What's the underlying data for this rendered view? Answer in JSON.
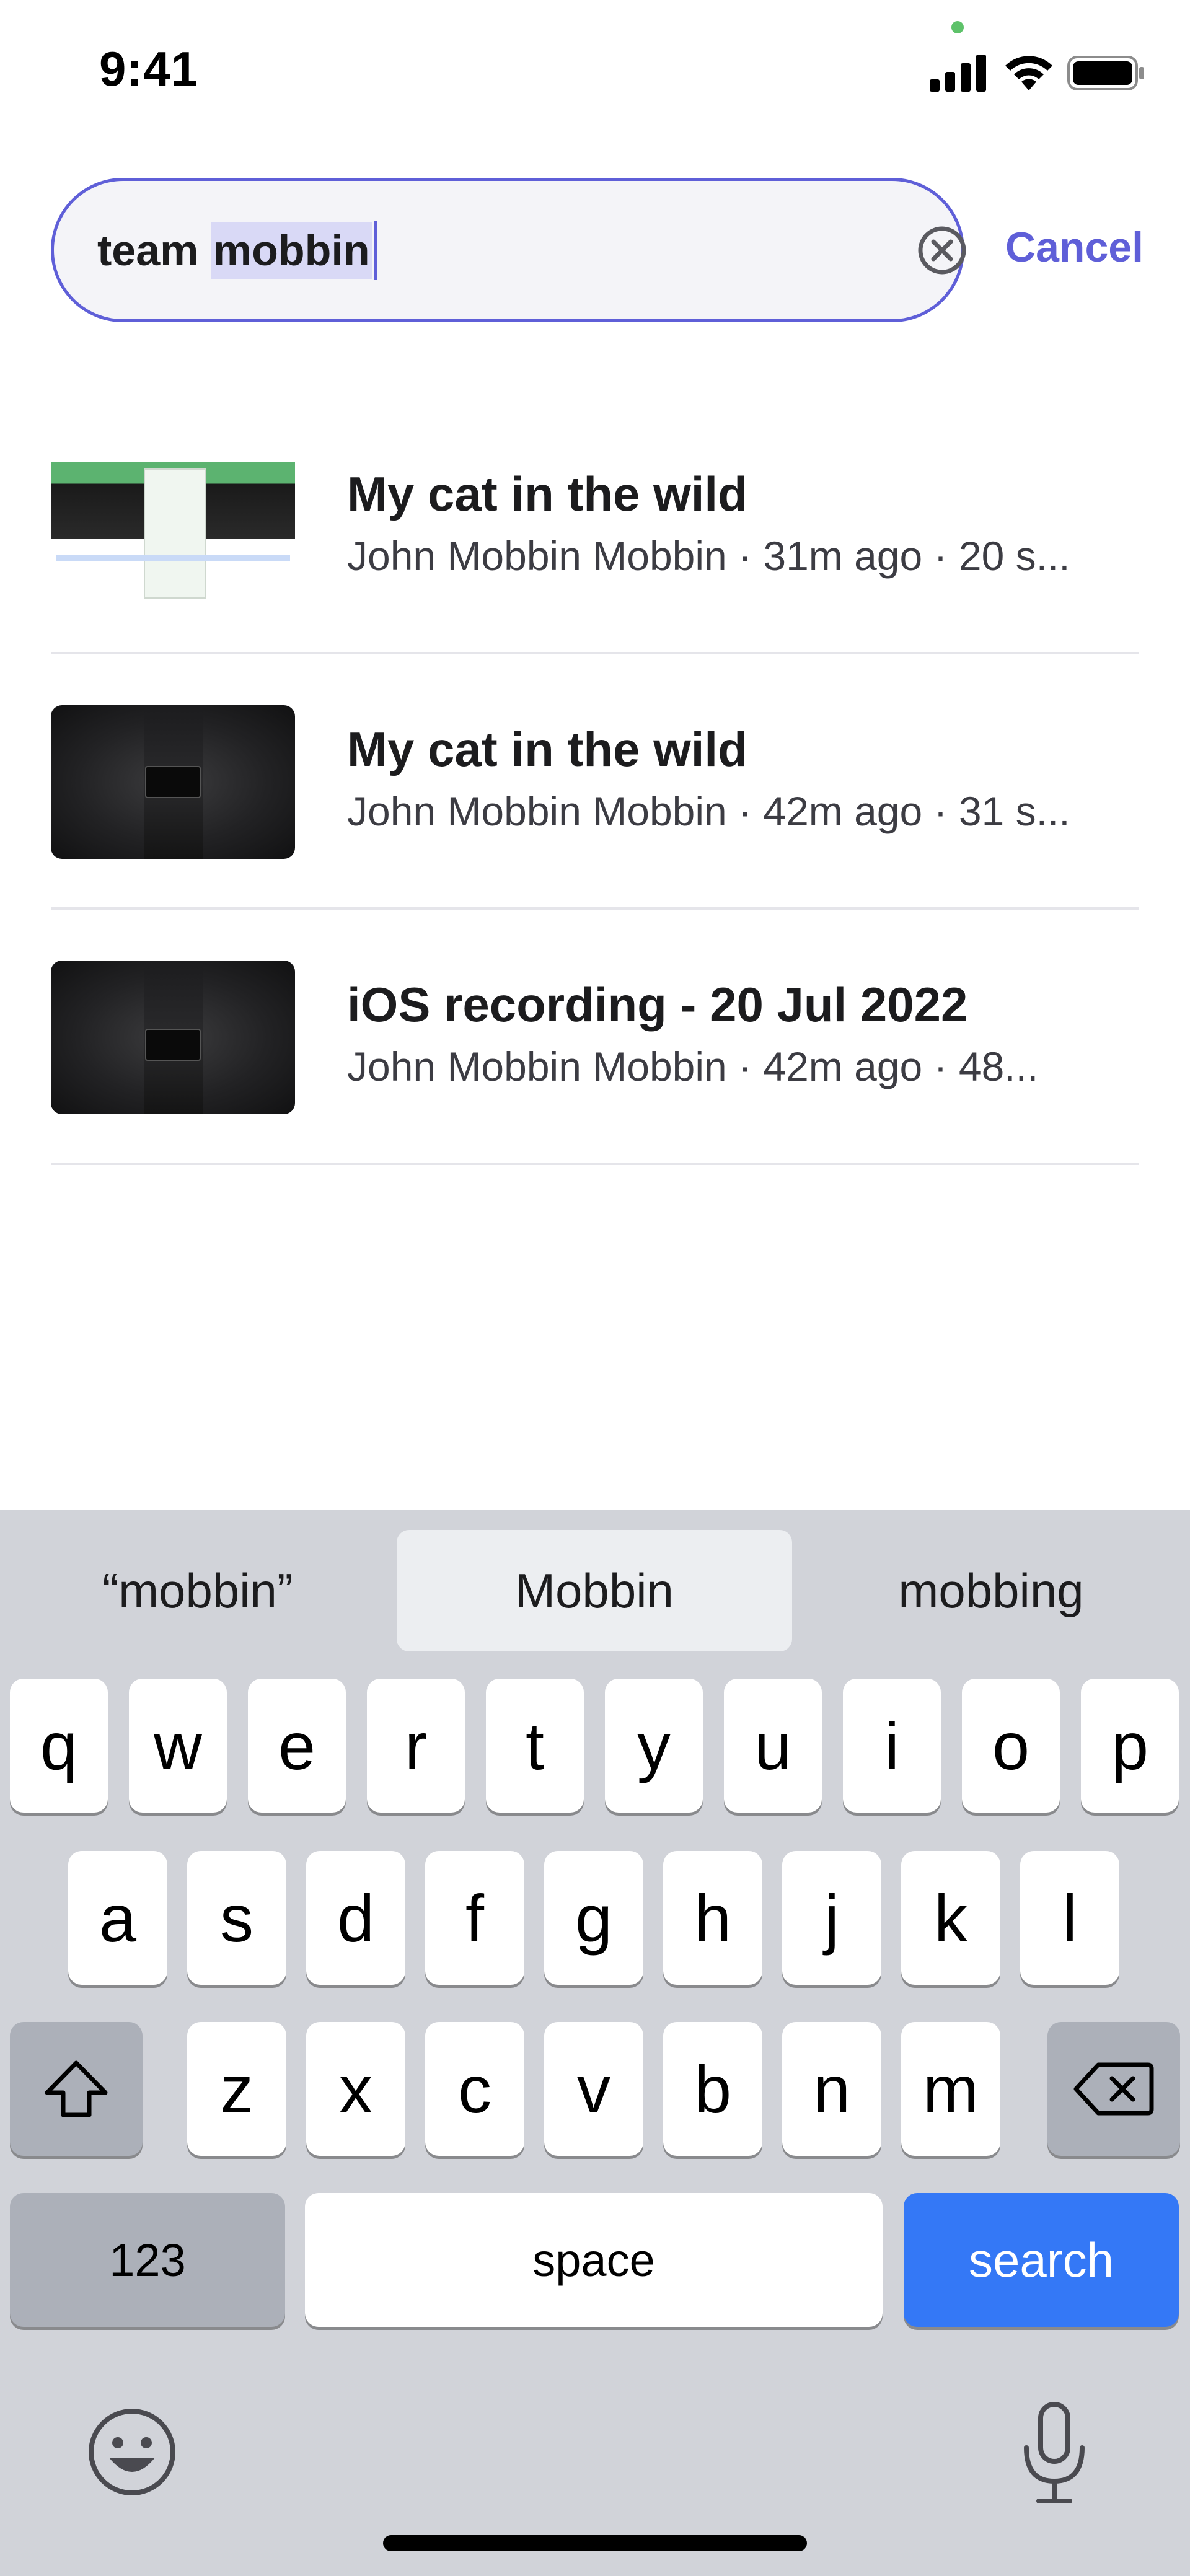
{
  "status_bar": {
    "time": "9:41"
  },
  "search": {
    "value_prefix": "team ",
    "value_selected": "mobbin",
    "cancel_label": "Cancel"
  },
  "results": [
    {
      "title": "My cat in the wild",
      "meta": "John Mobbin Mobbin · 31m ago · 20 s...",
      "thumbnail": "light"
    },
    {
      "title": "My cat in the wild",
      "meta": "John Mobbin Mobbin · 42m ago · 31 s...",
      "thumbnail": "dark"
    },
    {
      "title": "iOS recording - 20 Jul 2022",
      "meta": "John Mobbin Mobbin · 42m ago · 48...",
      "thumbnail": "dark"
    }
  ],
  "keyboard": {
    "suggestions": [
      "“mobbin”",
      "Mobbin",
      "mobbing"
    ],
    "row1": [
      "q",
      "w",
      "e",
      "r",
      "t",
      "y",
      "u",
      "i",
      "o",
      "p"
    ],
    "row2": [
      "a",
      "s",
      "d",
      "f",
      "g",
      "h",
      "j",
      "k",
      "l"
    ],
    "row3": [
      "z",
      "x",
      "c",
      "v",
      "b",
      "n",
      "m"
    ],
    "numbers_label": "123",
    "space_label": "space",
    "search_label": "search"
  },
  "colors": {
    "accent": "#5f5fd8",
    "search_key": "#3478f6"
  }
}
